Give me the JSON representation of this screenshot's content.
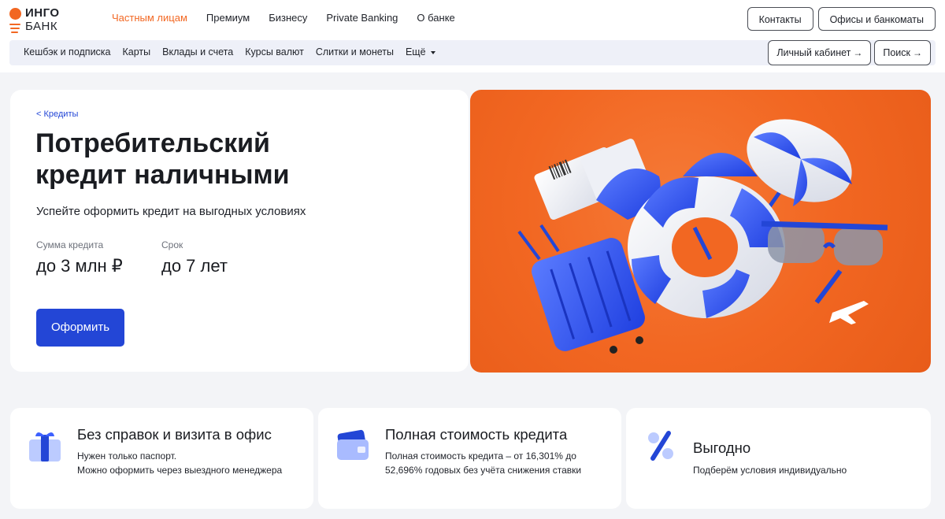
{
  "brand": {
    "line1": "ИНГО",
    "line2": "БАНК",
    "color": "#f26722",
    "accent": "#2346d6"
  },
  "main_nav": [
    {
      "label": "Частным лицам",
      "active": true
    },
    {
      "label": "Премиум"
    },
    {
      "label": "Бизнесу"
    },
    {
      "label": "Private Banking"
    },
    {
      "label": "О банке"
    }
  ],
  "top_buttons": {
    "contacts": "Контакты",
    "offices": "Офисы и банкоматы"
  },
  "sub_nav": [
    "Кешбэк и подписка",
    "Карты",
    "Вклады и счета",
    "Курсы валют",
    "Слитки и монеты",
    "Ещё"
  ],
  "sub_buttons": {
    "cabinet": "Личный кабинет",
    "search": "Поиск",
    "arrow": "→"
  },
  "hero": {
    "breadcrumb": "< Кредиты",
    "title": "Потребительский кредит наличными",
    "subtitle": "Успейте оформить кредит на выгодных условиях",
    "params": [
      {
        "label": "Сумма кредита",
        "value": "до 3 млн ₽"
      },
      {
        "label": "Срок",
        "value": "до 7 лет"
      }
    ],
    "cta": "Оформить",
    "image_icon": "travel-items-illustration"
  },
  "features": [
    {
      "icon": "gift-icon",
      "title": "Без справок и визита в офис",
      "lines": [
        "Нужен только паспорт.",
        "Можно оформить через выездного менеджера"
      ]
    },
    {
      "icon": "wallet-icon",
      "title": "Полная стоимость кредита",
      "lines": [
        "Полная стоимость кредита – от 16,301% до 52,696% годовых без учёта снижения ставки"
      ]
    },
    {
      "icon": "percent-icon",
      "title": "Выгодно",
      "lines": [
        "Подберём условия индивидуально"
      ]
    }
  ]
}
